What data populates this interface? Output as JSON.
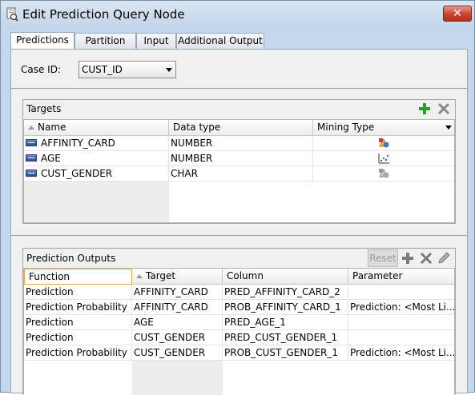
{
  "window": {
    "title": "Edit Prediction Query Node",
    "close_label": "✕"
  },
  "tabs": [
    "Predictions",
    "Partition",
    "Input",
    "Additional Output"
  ],
  "case_id": {
    "label": "Case ID:",
    "value": "CUST_ID"
  },
  "targets": {
    "title": "Targets",
    "columns": [
      "Name",
      "Data type",
      "Mining Type"
    ],
    "rows": [
      {
        "name": "AFFINITY_CARD",
        "type": "NUMBER",
        "mining": "categorical-icon"
      },
      {
        "name": "AGE",
        "type": "NUMBER",
        "mining": "numerical-icon"
      },
      {
        "name": "CUST_GENDER",
        "type": "CHAR",
        "mining": "categorical-icon"
      }
    ]
  },
  "outputs": {
    "title": "Prediction Outputs",
    "reset_label": "Reset",
    "columns": [
      "Function",
      "Target",
      "Column",
      "Parameter"
    ],
    "rows": [
      {
        "function": "Prediction",
        "target": "AFFINITY_CARD",
        "column": "PRED_AFFINITY_CARD_2",
        "param": ""
      },
      {
        "function": "Prediction Probability",
        "target": "AFFINITY_CARD",
        "column": "PROB_AFFINITY_CARD_1",
        "param": "Prediction: <Most Li..."
      },
      {
        "function": "Prediction",
        "target": "AGE",
        "column": "PRED_AGE_1",
        "param": ""
      },
      {
        "function": "Prediction",
        "target": "CUST_GENDER",
        "column": "PRED_CUST_GENDER_1",
        "param": ""
      },
      {
        "function": "Prediction Probability",
        "target": "CUST_GENDER",
        "column": "PROB_CUST_GENDER_1",
        "param": "Prediction: <Most Li..."
      }
    ]
  },
  "colors": {
    "accent_green": "#2e9a2e",
    "title_bar": "#c9daee",
    "close_red": "#c8442d"
  }
}
